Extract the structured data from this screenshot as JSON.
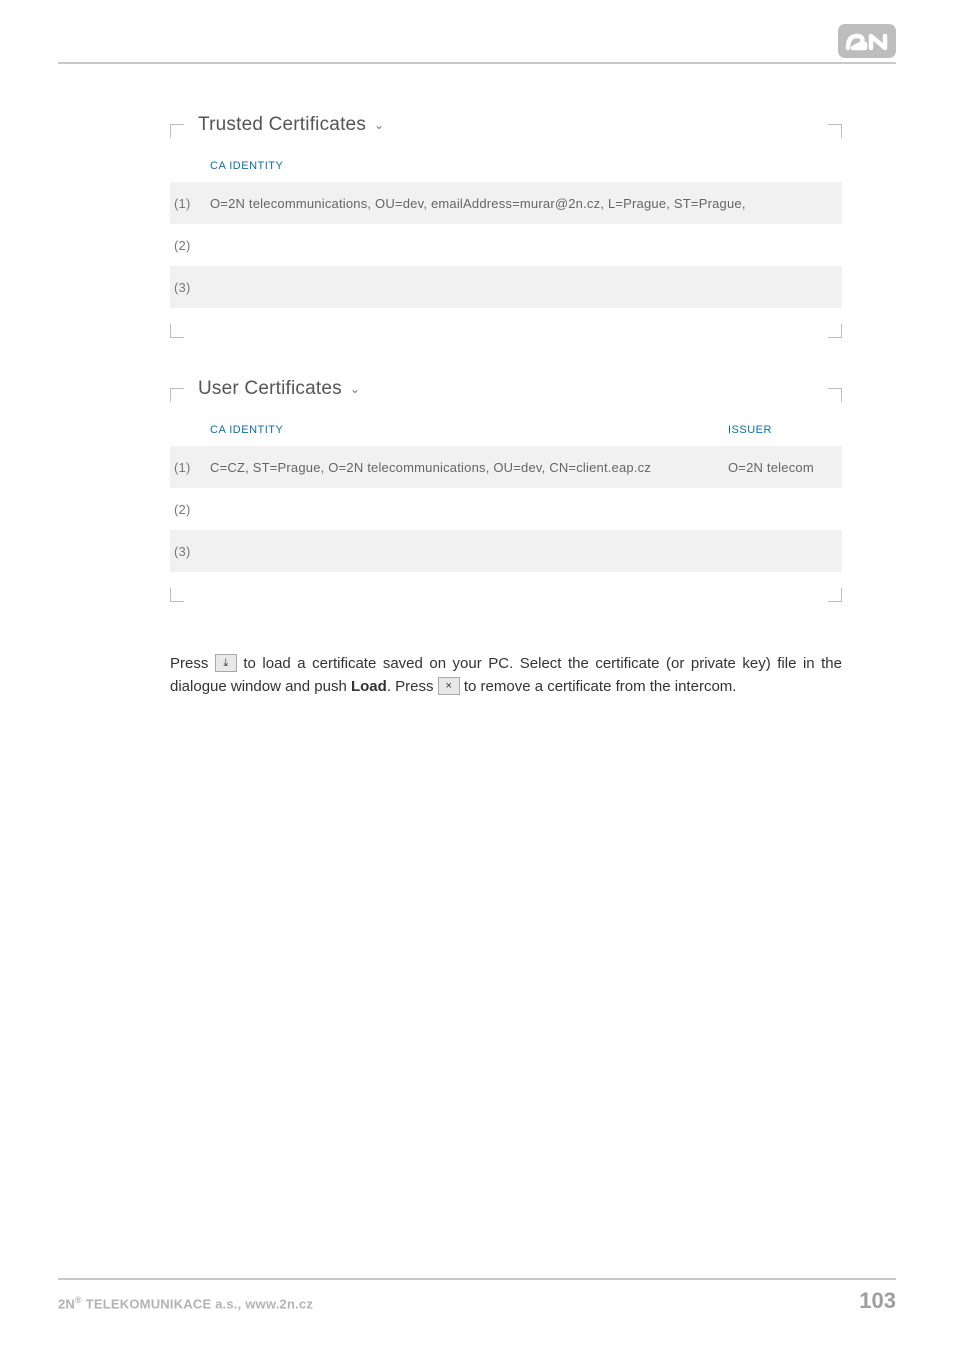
{
  "brand": "2N",
  "sections": {
    "trusted": {
      "title": "Trusted Certificates",
      "header_ca": "CA IDENTITY",
      "rows": [
        {
          "idx": "(1)",
          "identity": "O=2N telecommunications, OU=dev, emailAddress=murar@2n.cz, L=Prague, ST=Prague,"
        },
        {
          "idx": "(2)",
          "identity": ""
        },
        {
          "idx": "(3)",
          "identity": ""
        }
      ]
    },
    "user": {
      "title": "User Certificates",
      "header_ca": "CA IDENTITY",
      "header_issuer": "ISSUER",
      "rows": [
        {
          "idx": "(1)",
          "identity": "C=CZ, ST=Prague, O=2N telecommunications, OU=dev, CN=client.eap.cz",
          "issuer": "O=2N telecom"
        },
        {
          "idx": "(2)",
          "identity": "",
          "issuer": ""
        },
        {
          "idx": "(3)",
          "identity": "",
          "issuer": ""
        }
      ]
    }
  },
  "instructions": {
    "p1a": "Press ",
    "p1b": " to load a certificate saved on your PC. Select the certificate (or private key) file in the dialogue window and push ",
    "load": "Load",
    "p1c": ". Press ",
    "p1d": " to remove a certificate from the intercom."
  },
  "footer": {
    "company_prefix": "2N",
    "company_reg": "®",
    "company_rest": " TELEKOMUNIKACE a.s., www.2n.cz",
    "page": "103"
  },
  "icons": {
    "load": "⤓",
    "remove": "×"
  }
}
